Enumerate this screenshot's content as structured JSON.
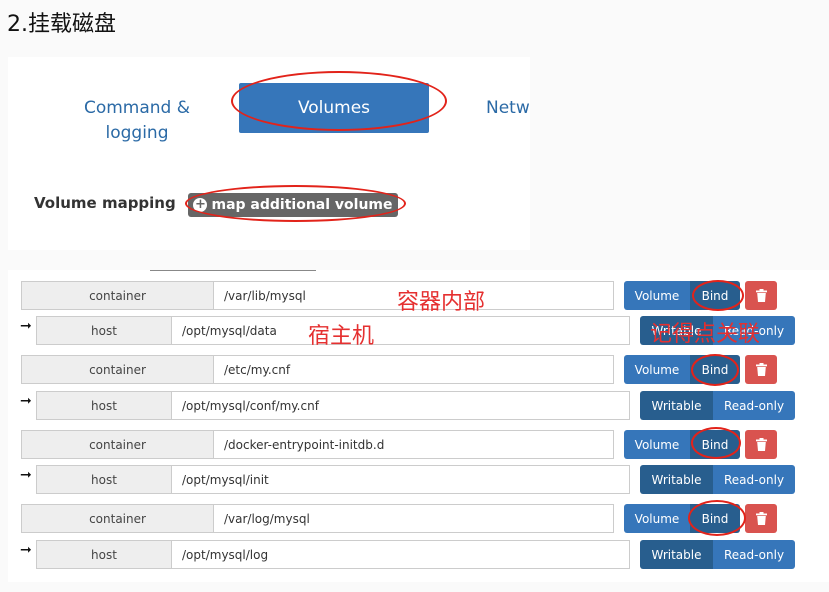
{
  "heading": "2.挂载磁盘",
  "tabs": {
    "command_line1": "Command &",
    "command_line2": "logging",
    "volumes": "Volumes",
    "network_partial": "Netw"
  },
  "volume_mapping": {
    "label": "Volume mapping",
    "button_label": "map additional volume",
    "plus_icon": "+"
  },
  "mappings": [
    {
      "container_label": "container",
      "container_path": "/var/lib/mysql",
      "volume_btn": "Volume",
      "bind_btn": "Bind",
      "arrow": "➞",
      "host_label": "host",
      "host_path": "/opt/mysql/data",
      "writable_btn": "Writable",
      "readonly_btn": "Read-only"
    },
    {
      "container_label": "container",
      "container_path": "/etc/my.cnf",
      "volume_btn": "Volume",
      "bind_btn": "Bind",
      "arrow": "➞",
      "host_label": "host",
      "host_path": "/opt/mysql/conf/my.cnf",
      "writable_btn": "Writable",
      "readonly_btn": "Read-only"
    },
    {
      "container_label": "container",
      "container_path": "/docker-entrypoint-initdb.d",
      "volume_btn": "Volume",
      "bind_btn": "Bind",
      "arrow": "➞",
      "host_label": "host",
      "host_path": "/opt/mysql/init",
      "writable_btn": "Writable",
      "readonly_btn": "Read-only"
    },
    {
      "container_label": "container",
      "container_path": "/var/log/mysql",
      "volume_btn": "Volume",
      "bind_btn": "Bind",
      "arrow": "➞",
      "host_label": "host",
      "host_path": "/opt/mysql/log",
      "writable_btn": "Writable",
      "readonly_btn": "Read-only"
    }
  ],
  "annotations": {
    "container_inside": "容器内部",
    "host_machine": "宿主机",
    "remember_link": "记得点关联"
  },
  "colors": {
    "primary": "#3676ba",
    "primary_dark": "#285e8e",
    "danger": "#d9534f",
    "annotation": "#e2231a"
  }
}
